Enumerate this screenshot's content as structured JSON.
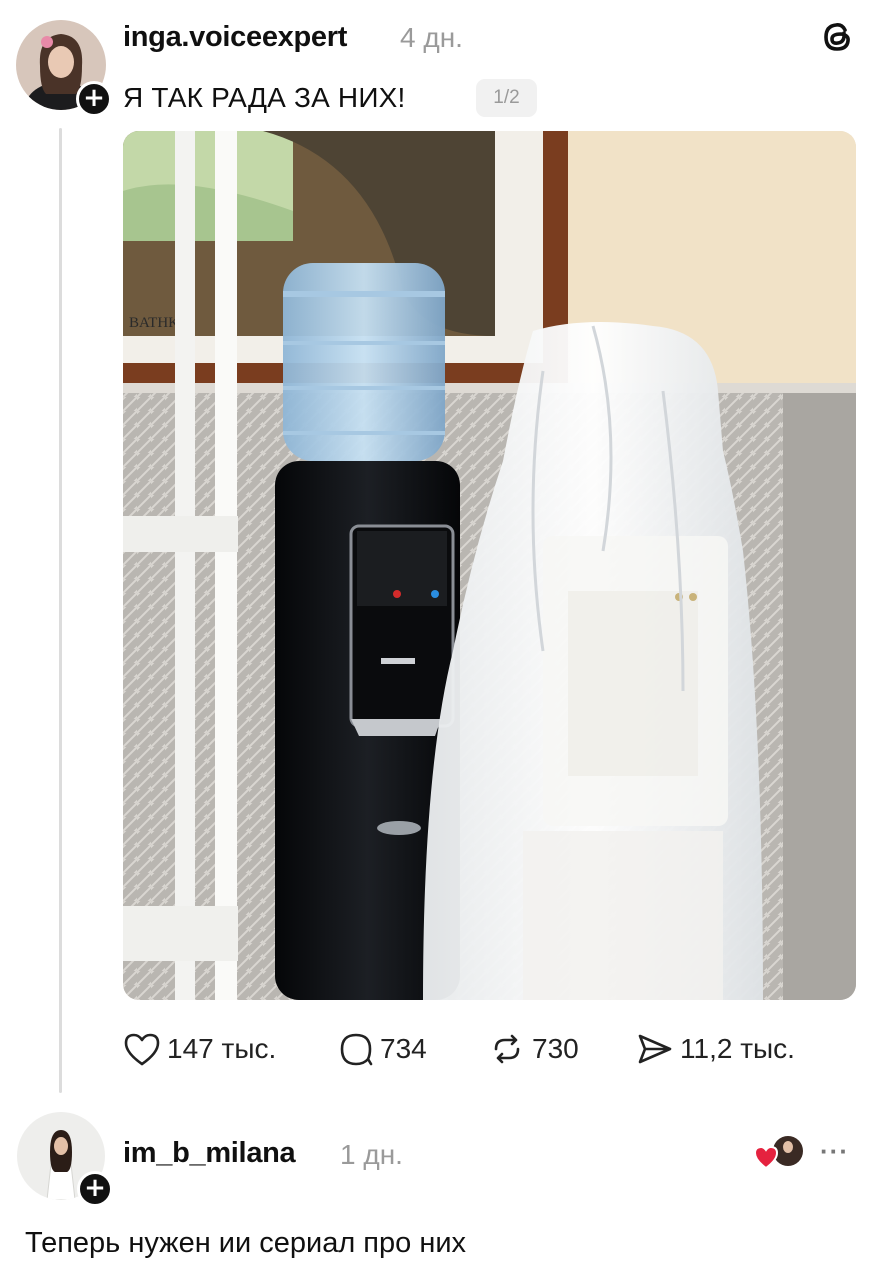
{
  "post": {
    "username": "inga.voiceexpert",
    "time": "4 дн.",
    "caption": "Я ТАК РАДА ЗА НИХ!",
    "pager": "1/2",
    "photo_sign_text": "BATHK",
    "actions": {
      "likes": "147 тыс.",
      "comments": "734",
      "reposts": "730",
      "shares": "11,2 тыс."
    }
  },
  "reply": {
    "username": "im_b_milana",
    "time": "1 дн.",
    "text": "Теперь нужен ии сериал про них",
    "more": "···"
  },
  "icons": {
    "app_logo": "threads-logo-icon",
    "follow": "plus-icon",
    "like": "heart-outline-icon",
    "comment": "speech-bubble-icon",
    "repost": "repost-arrows-icon",
    "share": "paper-plane-icon",
    "liked_by_author": "red-heart-icon"
  },
  "colors": {
    "text": "#101010",
    "muted": "#9a9a9a",
    "heart_red": "#e5223f"
  }
}
